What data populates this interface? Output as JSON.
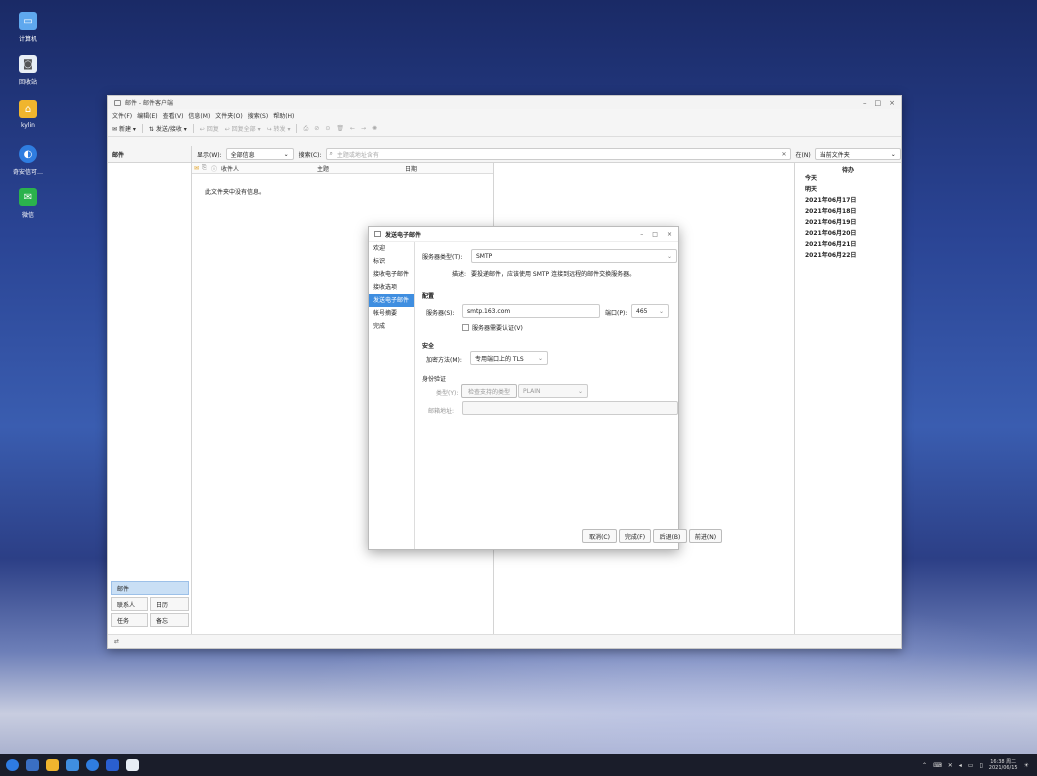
{
  "desktop": {
    "icons": [
      {
        "label": "计算机",
        "icon": "computer-icon"
      },
      {
        "label": "回收站",
        "icon": "trash-icon"
      },
      {
        "label": "kylin",
        "icon": "home-folder-icon"
      },
      {
        "label": "奇安信可…",
        "icon": "browser-icon"
      },
      {
        "label": "微信",
        "icon": "wechat-icon"
      }
    ]
  },
  "window": {
    "title": "邮件 - 邮件客户端",
    "menu": [
      "文件(F)",
      "编辑(E)",
      "查看(V)",
      "信息(M)",
      "文件夹(O)",
      "搜索(S)",
      "帮助(H)"
    ],
    "toolbar": {
      "new": "新建",
      "send_receive": "发送/接收",
      "reply": "回复",
      "reply_all": "回复全部",
      "forward": "转发"
    },
    "folder_header": "邮件",
    "show_label": "显示(W):",
    "show_value": "全部信息",
    "search_label": "搜索(C):",
    "search_placeholder": "主题或地址含有",
    "scope_label": "在(N)",
    "scope_value": "当前文件夹",
    "columns": {
      "recipient": "收件人",
      "subject": "主题",
      "date": "日期"
    },
    "empty_text": "此文件夹中没有信息。",
    "todo_title": "待办",
    "todo_items": [
      "今天",
      "明天",
      "2021年06月17日",
      "2021年06月18日",
      "2021年06月19日",
      "2021年06月20日",
      "2021年06月21日",
      "2021年06月22日"
    ],
    "nav": {
      "mail": "邮件",
      "contacts": "联系人",
      "calendar": "日历",
      "tasks": "任务",
      "memos": "备忘"
    }
  },
  "dialog": {
    "title": "发送电子邮件",
    "steps": [
      "欢迎",
      "标识",
      "接收电子邮件",
      "接收选项",
      "发送电子邮件",
      "帐号摘要",
      "完成"
    ],
    "active_step": "发送电子邮件",
    "server_type_label": "服务器类型(T):",
    "server_type_value": "SMTP",
    "desc_label": "描述:",
    "desc_text": "要投递邮件，应该使用 SMTP 连接到远程的邮件交换服务器。",
    "config_heading": "配置",
    "server_label": "服务器(S):",
    "server_value": "smtp.163.com",
    "port_label": "端口(P):",
    "port_value": "465",
    "auth_required_label": "服务器需要认证(V)",
    "security_heading": "安全",
    "encryption_label": "加密方法(M):",
    "encryption_value": "专用端口上的 TLS",
    "auth_heading": "身份验证",
    "type_label": "类型(Y):",
    "check_types_label": "检查支持的类型",
    "auth_type_value": "PLAIN",
    "email_label": "邮箱地址:",
    "buttons": {
      "cancel": "取消(C)",
      "finish": "完成(F)",
      "back": "后退(B)",
      "next": "前进(N)"
    }
  },
  "taskbar": {
    "time": "16:38 周二",
    "date": "2021/06/15"
  }
}
